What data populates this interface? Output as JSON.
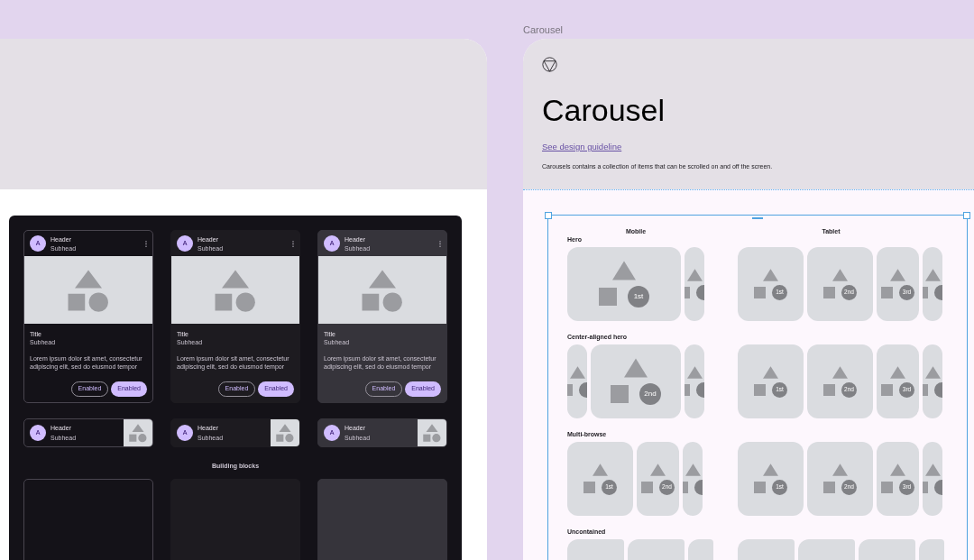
{
  "cards": [
    {
      "kind": "outlined",
      "avatar": "A",
      "header": "Header",
      "subhead": "Subhead",
      "title": "Title",
      "title_subhead": "Subhead",
      "body": "Lorem ipsum dolor sit amet, consectetur adipiscing elit, sed do eiusmod tempor",
      "buttons": [
        {
          "label": "Enabled",
          "kind": "outlined"
        },
        {
          "label": "Enabled",
          "kind": "filled"
        }
      ]
    },
    {
      "kind": "filled",
      "avatar": "A",
      "header": "Header",
      "subhead": "Subhead",
      "title": "Title",
      "title_subhead": "Subhead",
      "body": "Lorem ipsum dolor sit amet, consectetur adipiscing elit, sed do eiusmod tempor",
      "buttons": [
        {
          "label": "Enabled",
          "kind": "outlined"
        },
        {
          "label": "Enabled",
          "kind": "filled"
        }
      ]
    },
    {
      "kind": "elevated",
      "avatar": "A",
      "header": "Header",
      "subhead": "Subhead",
      "title": "Title",
      "title_subhead": "Subhead",
      "body": "Lorem ipsum dolor sit amet, consectetur adipiscing elit, sed do eiusmod tempor",
      "buttons": [
        {
          "label": "Enabled",
          "kind": "outlined"
        },
        {
          "label": "Enabled",
          "kind": "filled"
        }
      ]
    }
  ],
  "list_cards": [
    {
      "kind": "outlined",
      "avatar": "A",
      "header": "Header",
      "subhead": "Subhead"
    },
    {
      "kind": "filled",
      "avatar": "A",
      "header": "Header",
      "subhead": "Subhead"
    },
    {
      "kind": "elevated",
      "avatar": "A",
      "header": "Header",
      "subhead": "Subhead"
    }
  ],
  "building_blocks": {
    "title": "Building blocks",
    "blocks": [
      {
        "kind": "outlined"
      },
      {
        "kind": "filled"
      },
      {
        "kind": "elevated"
      }
    ]
  },
  "frame_label": "Carousel",
  "doc": {
    "title": "Carousel",
    "link": "See design guideline",
    "description": "Carousels contains a collection of items that can be scrolled on and off the screen."
  },
  "columns": [
    "Mobile",
    "Tablet"
  ],
  "rows": [
    {
      "label": "Hero",
      "mobile": [
        {
          "kind": "large",
          "label": "1st"
        },
        {
          "kind": "peek"
        }
      ],
      "tablet": [
        {
          "kind": "medium",
          "label": "1st"
        },
        {
          "kind": "medium",
          "label": "2nd"
        },
        {
          "kind": "small",
          "label": "3rd"
        },
        {
          "kind": "peek"
        }
      ]
    },
    {
      "label": "Center-aligned hero",
      "mobile": [
        {
          "kind": "peek"
        },
        {
          "kind": "wide",
          "label": "2nd"
        },
        {
          "kind": "peek"
        }
      ],
      "tablet": [
        {
          "kind": "medium",
          "label": "1st"
        },
        {
          "kind": "medium",
          "label": "2nd"
        },
        {
          "kind": "small",
          "label": "3rd"
        },
        {
          "kind": "peek"
        }
      ]
    },
    {
      "label": "Multi-browse",
      "mobile": [
        {
          "kind": "medium",
          "label": "1st"
        },
        {
          "kind": "small",
          "label": "2nd"
        },
        {
          "kind": "peek"
        }
      ],
      "tablet": [
        {
          "kind": "medium",
          "label": "1st"
        },
        {
          "kind": "medium",
          "label": "2nd"
        },
        {
          "kind": "small",
          "label": "3rd"
        },
        {
          "kind": "peek"
        }
      ]
    },
    {
      "label": "Uncontained",
      "mobile": [
        {
          "kind": "uniform"
        },
        {
          "kind": "uniform"
        },
        {
          "kind": "partial"
        }
      ],
      "tablet": [
        {
          "kind": "uniform"
        },
        {
          "kind": "uniform"
        },
        {
          "kind": "uniform"
        },
        {
          "kind": "partial"
        }
      ]
    }
  ]
}
